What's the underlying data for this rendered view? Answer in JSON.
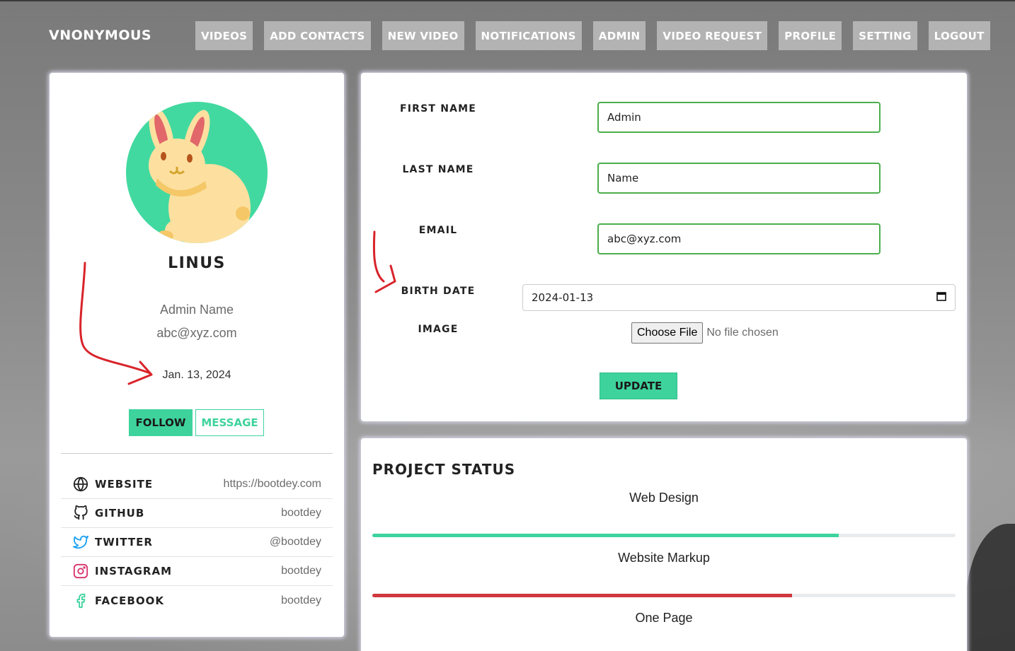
{
  "brand": "VNONYMOUS",
  "nav": [
    "VIDEOS",
    "ADD CONTACTS",
    "NEW VIDEO",
    "NOTIFICATIONS",
    "ADMIN",
    "VIDEO REQUEST",
    "PROFILE",
    "SETTING",
    "LOGOUT"
  ],
  "profile": {
    "name": "LINUS",
    "full_name": "Admin Name",
    "email": "abc@xyz.com",
    "birth_date_display": "Jan. 13, 2024",
    "follow_label": "FOLLOW",
    "message_label": "MESSAGE",
    "avatar_icon": "rabbit-avatar"
  },
  "social": [
    {
      "label": "WEBSITE",
      "value": "https://bootdey.com",
      "icon": "globe-icon",
      "color": "#222222"
    },
    {
      "label": "GITHUB",
      "value": "bootdey",
      "icon": "github-icon",
      "color": "#222222"
    },
    {
      "label": "TWITTER",
      "value": "@bootdey",
      "icon": "twitter-icon",
      "color": "#1da1f2"
    },
    {
      "label": "INSTAGRAM",
      "value": "bootdey",
      "icon": "instagram-icon",
      "color": "#d6336c"
    },
    {
      "label": "FACEBOOK",
      "value": "bootdey",
      "icon": "facebook-icon",
      "color": "#3ed39d"
    }
  ],
  "form": {
    "first_name_label": "FIRST NAME",
    "first_name_value": "Admin",
    "last_name_label": "LAST NAME",
    "last_name_value": "Name",
    "email_label": "EMAIL",
    "email_value": "abc@xyz.com",
    "birth_date_label": "BIRTH DATE",
    "birth_date_value": "2024-01-13",
    "image_label": "IMAGE",
    "file_button": "Choose File",
    "file_status": "No file chosen",
    "update_label": "UPDATE"
  },
  "project_status": {
    "title": "PROJECT STATUS",
    "items": [
      {
        "label": "Web Design",
        "progress": 80,
        "color": "#3ed39d"
      },
      {
        "label": "Website Markup",
        "progress": 72,
        "color": "#d0383f"
      },
      {
        "label": "One Page"
      }
    ]
  },
  "colors": {
    "accent": "#3ed39d",
    "input_border": "#4cae4c",
    "annotation": "#d9232a"
  }
}
